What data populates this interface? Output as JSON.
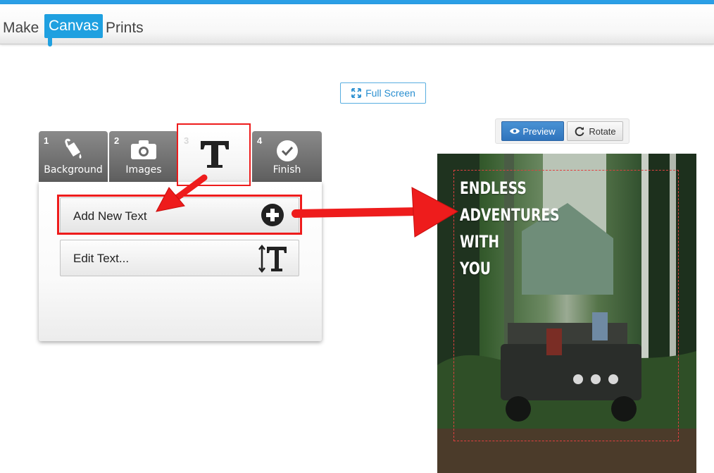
{
  "header": {
    "logo": {
      "make": "Make",
      "canvas": "Canvas",
      "prints": "Prints"
    }
  },
  "toolbar": {
    "fullscreen_label": "Full Screen"
  },
  "tabs": [
    {
      "num": "1",
      "label": "Background",
      "icon": "paint-bucket-icon"
    },
    {
      "num": "2",
      "label": "Images",
      "icon": "camera-icon"
    },
    {
      "num": "3",
      "label": "",
      "icon": "text-t-icon"
    },
    {
      "num": "4",
      "label": "Finish",
      "icon": "check-circle-icon"
    }
  ],
  "panel": {
    "add_text_label": "Add New Text",
    "edit_text_label": "Edit Text..."
  },
  "preview": {
    "preview_label": "Preview",
    "rotate_label": "Rotate",
    "poster_lines": [
      "ENDLESS",
      "ADVENTURES",
      "WITH",
      "YOU"
    ]
  },
  "colors": {
    "accent": "#2b9fe6",
    "highlight": "#ee1c1c",
    "preview_button": "#2f74bd"
  }
}
